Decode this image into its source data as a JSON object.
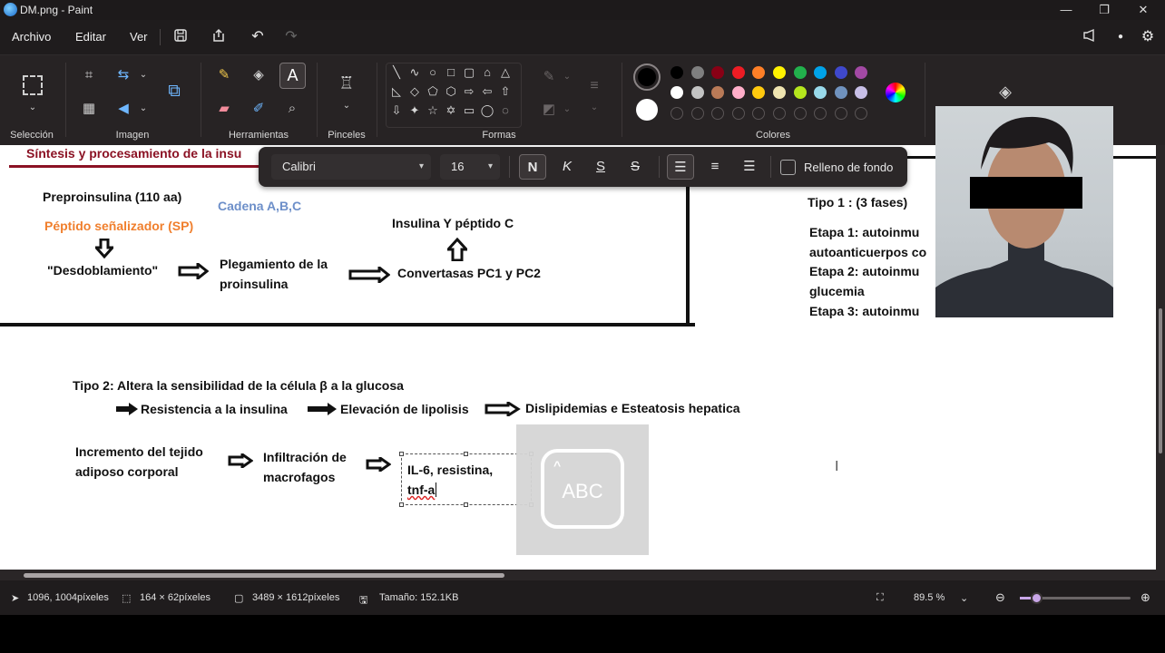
{
  "window": {
    "title": "DM.png - Paint",
    "controls": {
      "minimize": "—",
      "maximize": "❐",
      "close": "✕"
    }
  },
  "menu": {
    "items": [
      "Archivo",
      "Editar",
      "Ver"
    ]
  },
  "ribbon": {
    "groups": {
      "selection": "Selección",
      "image": "Imagen",
      "tools": "Herramientas",
      "brushes": "Pinceles",
      "shapes": "Formas",
      "colors": "Colores"
    },
    "palette_row1": [
      "#000000",
      "#7f7f7f",
      "#880015",
      "#ed1c24",
      "#ff7f27",
      "#fff200",
      "#22b14c",
      "#00a2e8",
      "#3f48cc",
      "#a349a4"
    ],
    "palette_row2": [
      "#ffffff",
      "#c3c3c3",
      "#b97a57",
      "#ffaec9",
      "#ffc90e",
      "#efe4b0",
      "#b5e61d",
      "#99d9ea",
      "#7092be",
      "#c8bfe7"
    ],
    "primary_color": "#000000",
    "secondary_color": "#ffffff"
  },
  "text_toolbar": {
    "font": "Calibri",
    "size": "16",
    "bold": "N",
    "italic": "K",
    "underline": "S",
    "strike": "S",
    "fill_label": "Relleno de fondo"
  },
  "canvas": {
    "header": "Síntesis y procesamiento de la insu",
    "preproinsulina": "Preproinsulina  (110 aa)",
    "peptido_senal": "Péptido señalizador (SP)",
    "cadena": "Cadena A,B,C",
    "insulina_peptido": "Insulina Y péptido C",
    "desdoblamiento": "\"Desdoblamiento\"",
    "plegamiento": "Plegamiento de la\nproinsulina",
    "convertasas": "Convertasas PC1 y PC2",
    "tipo1": "Tipo 1 : (3 fases)",
    "etapa1": "Etapa 1: autoinmu",
    "autoanticuerpos": "autoanticuerpos co",
    "etapa2": "Etapa 2: autoinmu",
    "glucemia": "glucemia",
    "etapa3": "Etapa 3: autoinmu",
    "tipo2": "Tipo 2:   Altera la sensibilidad de la célula β a la glucosa",
    "resistencia": "Resistencia a la insulina",
    "lipolisis": "Elevación de lipolisis",
    "dislipidemias": "Dislipidemias e Esteatosis hepatica",
    "incremento": "Incremento del tejido\nadiposo corporal",
    "infiltracion": "Infiltración de\nmacrofagos",
    "il6": "IL-6, resistina,",
    "tnf": "tnf-a",
    "abc": "ABC"
  },
  "status": {
    "cursor": "1096, 1004píxeles",
    "selection": "164 × 62píxeles",
    "image_size": "3489 × 1612píxeles",
    "file_size": "Tamaño: 152.1KB",
    "zoom": "89.5 %"
  }
}
